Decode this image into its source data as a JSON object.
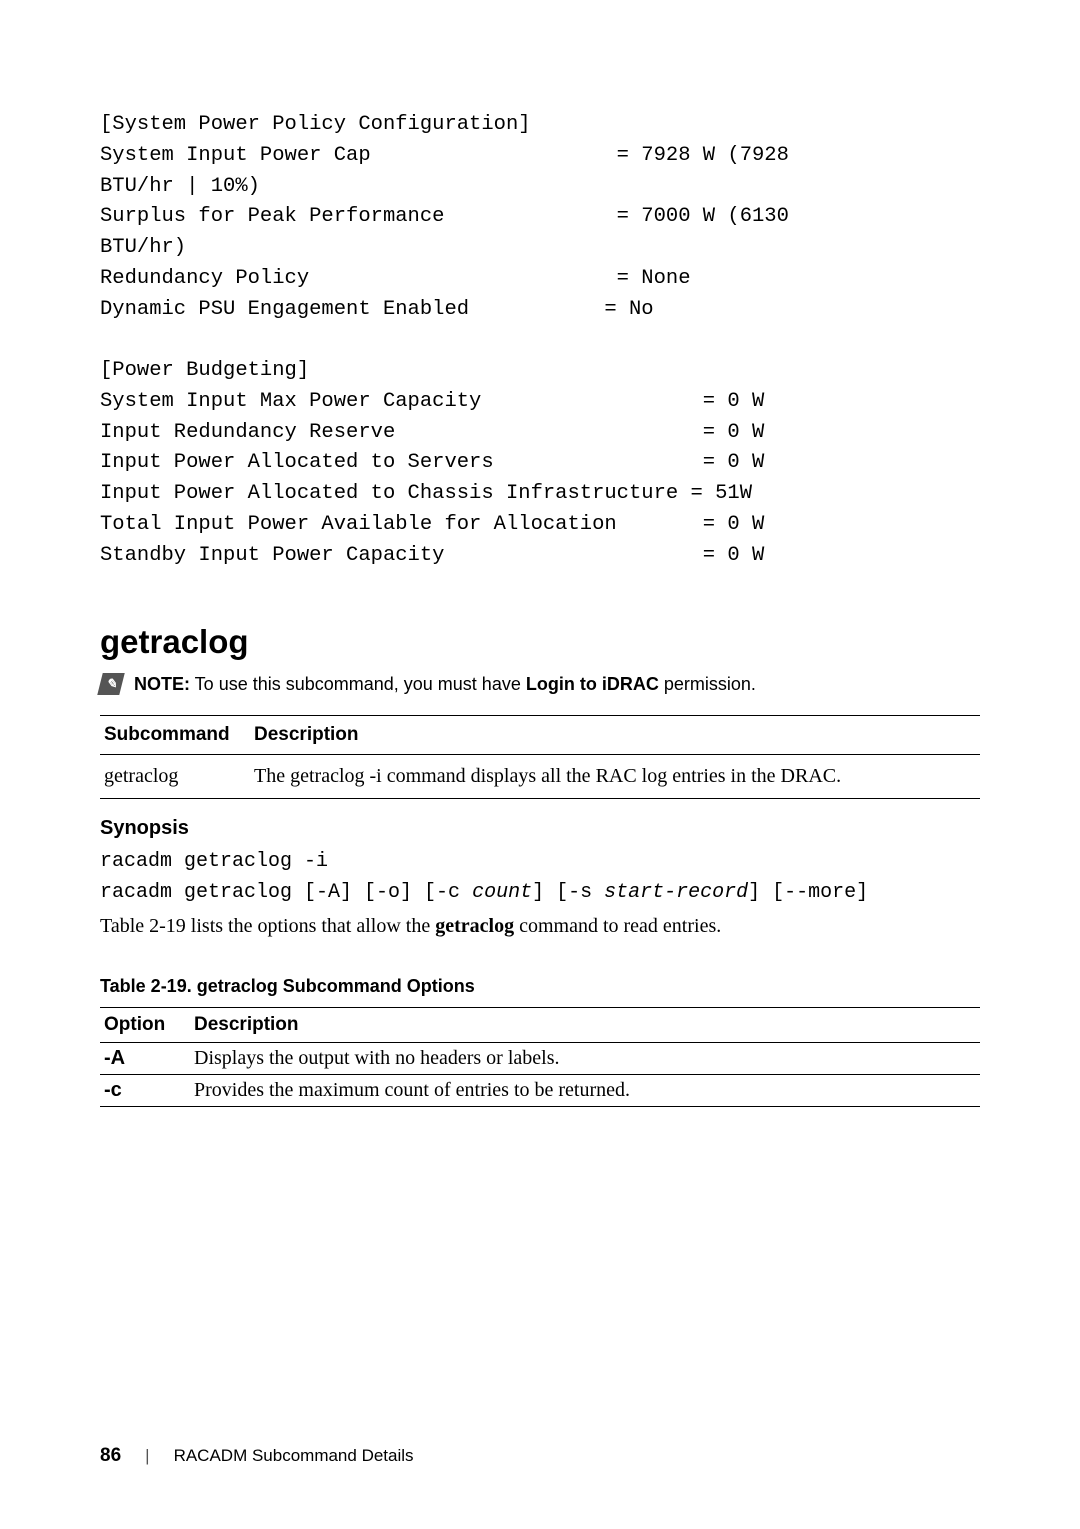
{
  "codeblock": "[System Power Policy Configuration]\nSystem Input Power Cap                    = 7928 W (7928\nBTU/hr | 10%)\nSurplus for Peak Performance              = 7000 W (6130\nBTU/hr)\nRedundancy Policy                         = None\nDynamic PSU Engagement Enabled           = No\n\n[Power Budgeting]\nSystem Input Max Power Capacity                  = 0 W\nInput Redundancy Reserve                         = 0 W\nInput Power Allocated to Servers                 = 0 W\nInput Power Allocated to Chassis Infrastructure = 51W\nTotal Input Power Available for Allocation       = 0 W\nStandby Input Power Capacity                     = 0 W",
  "section_title": "getraclog",
  "note": {
    "label": "NOTE:",
    "text_pre": " To use this subcommand, you must have ",
    "text_bold": "Login to iDRAC",
    "text_post": " permission."
  },
  "sub_table": {
    "headers": {
      "subcommand": "Subcommand",
      "description": "Description"
    },
    "rows": [
      {
        "subcommand": "getraclog",
        "description": "The getraclog -i command displays all the RAC log entries in the DRAC."
      }
    ]
  },
  "synopsis": {
    "heading": "Synopsis",
    "line1": "racadm getraclog -i",
    "line2": {
      "p1": "racadm getraclog [-A] [-o] [-c ",
      "i1": "count",
      "p2": "] [-s ",
      "i2": "start-record",
      "p3": "] [--more]"
    }
  },
  "body_text": {
    "pre": "Table 2-19 lists the options that allow the ",
    "bold": "getraclog",
    "post": " command to read entries."
  },
  "options_table": {
    "caption": "Table 2-19.    getraclog Subcommand Options",
    "headers": {
      "option": "Option",
      "description": "Description"
    },
    "rows": [
      {
        "option": "-A",
        "description": "Displays the output with no headers or labels."
      },
      {
        "option": "-c",
        "description": "Provides the maximum count of entries to be returned."
      }
    ]
  },
  "footer": {
    "page": "86",
    "section": "RACADM Subcommand Details"
  }
}
